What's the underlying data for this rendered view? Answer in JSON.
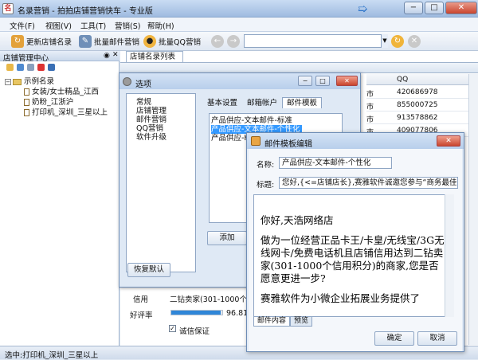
{
  "app": {
    "title": "名录营销 - 拍拍店铺营销快车 - 专业版",
    "icon_text": "名"
  },
  "menu": [
    "文件(F)",
    "视图(V)",
    "工具(T)",
    "营销(S)",
    "帮助(H)"
  ],
  "toolbar": {
    "refresh_label": "更新店铺名录",
    "batch_mail_label": "批量邮件营销",
    "batch_qq_label": "批量QQ营销",
    "address_value": ""
  },
  "left_panel": {
    "title": "店铺管理中心",
    "root": "示例名录",
    "items": [
      "女装/女士精品_江西",
      "奶粉_江浙沪",
      "打印机_深圳_三星以上"
    ]
  },
  "main_tab": {
    "label": "店铺名录列表"
  },
  "grid": {
    "qq_header": "QQ",
    "rows": [
      {
        "c1": "市",
        "qq": "420686978"
      },
      {
        "c1": "市",
        "qq": "855000725"
      },
      {
        "c1": "市",
        "qq": "913578862"
      },
      {
        "c1": "市",
        "qq": "409077806"
      }
    ]
  },
  "info": {
    "credit_label": "信用",
    "credit_value": "二钻卖家(301-1000个信用",
    "rating_label": "好评率",
    "rating_value": "96.81",
    "rating_fraction": 0.97,
    "guarantee_label": "诚信保证"
  },
  "status": {
    "text": "选中:打印机_深圳_三星以上"
  },
  "options_dialog": {
    "title": "选项",
    "tree": [
      "常规",
      "店铺管理",
      "邮件营销",
      "QQ营销",
      "软件升级"
    ],
    "tabs": [
      "基本设置",
      "邮箱帐户",
      "邮件模板"
    ],
    "templates": [
      "产品供应-文本邮件-标准",
      "产品供应-文本邮件-个性化",
      "产品供应-HT"
    ],
    "add_button": "添加",
    "restore_button": "恢复默认"
  },
  "template_dialog": {
    "title": "邮件模板编辑",
    "name_label": "名称:",
    "name_value": "产品供应-文本邮件-个性化",
    "subject_label": "标题:",
    "subject_value": "您好,{<=店铺店长},赛雅软件诚邀您参与“商务最佳",
    "content": [
      "你好,天浩网络店",
      "做为一位经营正品卡王/卡皇/无线宝/3G无线网卡/免费电话机且店铺信用达到二钻卖家(301-1000个信用积分)的商家,您是否愿意更进一步?",
      "赛雅软件为小微企业拓展业务提供了"
    ],
    "tabs": [
      "邮件内容",
      "预览"
    ],
    "ok_button": "确定",
    "cancel_button": "取消"
  }
}
